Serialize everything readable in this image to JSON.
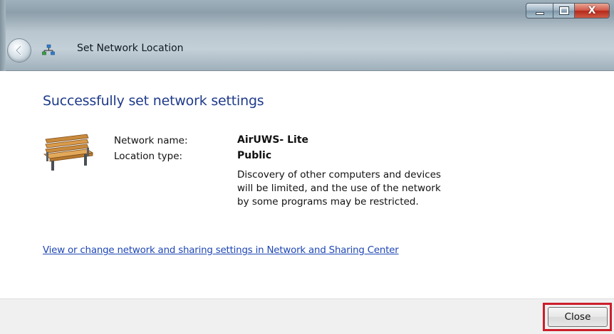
{
  "window": {
    "title": "Set Network Location",
    "controls": {
      "minimize_icon": "minimize-icon",
      "maximize_icon": "maximize-icon",
      "close_glyph": "X"
    }
  },
  "content": {
    "heading": "Successfully set network settings",
    "icon": "park-bench-icon",
    "fields": {
      "network_name_label": "Network name:",
      "network_name_value": "AirUWS- Lite",
      "location_type_label": "Location type:",
      "location_type_value": "Public"
    },
    "description_lines": [
      "Discovery of other computers and devices",
      "will be limited, and the use of the network",
      "by some programs may be restricted."
    ],
    "link": "View or change network and sharing settings in Network and Sharing Center"
  },
  "footer": {
    "close_label": "Close",
    "highlight_color": "#cc1e2a"
  },
  "colors": {
    "heading": "#1e3a8a",
    "link": "#1f47b5"
  }
}
